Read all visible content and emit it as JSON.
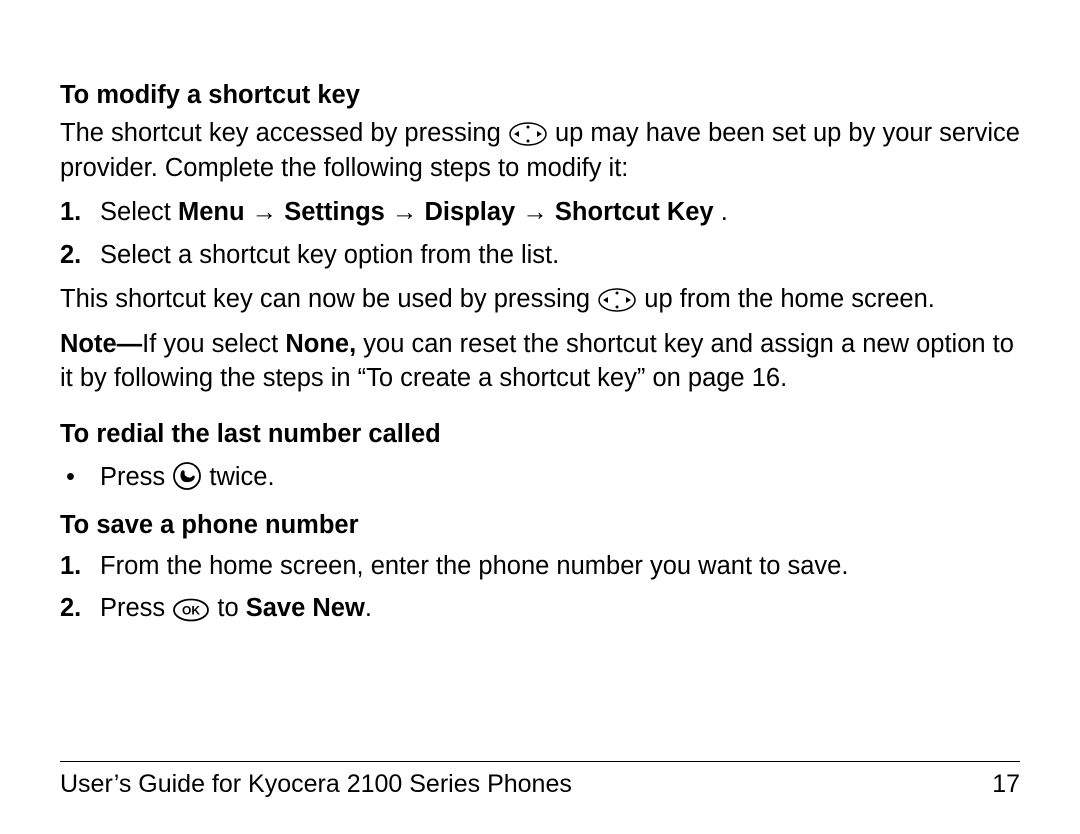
{
  "sections": {
    "modify": {
      "heading": "To modify a shortcut key",
      "intro_a": "The shortcut key accessed by pressing ",
      "intro_b": " up may have been set up by your service provider. Complete the following steps to modify it:",
      "step1_num": "1.",
      "step1_lead": "Select ",
      "step1_path_a": "Menu ",
      "step1_path_b": " Settings ",
      "step1_path_c": " Display ",
      "step1_path_d": " Shortcut Key",
      "step1_dot": ".",
      "arrow": "→",
      "step2_num": "2.",
      "step2_text": "Select a shortcut key option from the list.",
      "after_a": "This shortcut key can now be used by pressing ",
      "after_b": " up from the home screen.",
      "note_label": "Note—",
      "note_a": "If you select ",
      "note_none": "None,",
      "note_b": " you can reset the shortcut key and assign a new option to it by following the steps in “To create a shortcut key” on page 16."
    },
    "redial": {
      "heading": "To redial the last number called",
      "bullet_a": "Press ",
      "bullet_b": " twice."
    },
    "save": {
      "heading": "To save a phone number",
      "step1_num": "1.",
      "step1_text": "From the home screen, enter the phone number you want to save.",
      "step2_num": "2.",
      "step2_a": "Press ",
      "step2_b": " to ",
      "step2_c": "Save New",
      "step2_dot": "."
    }
  },
  "footer": {
    "title": "User’s Guide for Kyocera 2100 Series Phones",
    "page": "17"
  }
}
